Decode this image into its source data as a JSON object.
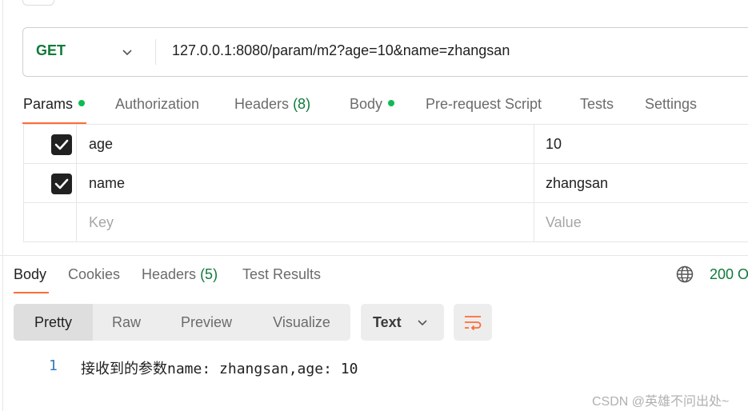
{
  "request": {
    "method": "GET",
    "url": "127.0.0.1:8080/param/m2?age=10&name=zhangsan"
  },
  "request_tabs": [
    {
      "label": "Params",
      "dot": true,
      "active": true
    },
    {
      "label": "Authorization"
    },
    {
      "label": "Headers",
      "count": "(8)"
    },
    {
      "label": "Body",
      "dot": true
    },
    {
      "label": "Pre-request Script"
    },
    {
      "label": "Tests"
    },
    {
      "label": "Settings"
    }
  ],
  "params": [
    {
      "key": "age",
      "value": "10",
      "checked": true
    },
    {
      "key": "name",
      "value": "zhangsan",
      "checked": true
    }
  ],
  "params_placeholder": {
    "key": "Key",
    "value": "Value"
  },
  "response_tabs": [
    {
      "label": "Body",
      "active": true
    },
    {
      "label": "Cookies"
    },
    {
      "label": "Headers",
      "count": "(5)"
    },
    {
      "label": "Test Results"
    }
  ],
  "status": "200 O",
  "view_modes": [
    "Pretty",
    "Raw",
    "Preview",
    "Visualize"
  ],
  "format": "Text",
  "response_body": {
    "line": "1",
    "text": "接收到的参数name: zhangsan,age: 10"
  },
  "watermark": "CSDN @英雄不问出处~",
  "colors": {
    "accent": "#ff6c37",
    "success": "#0cbb52",
    "method": "#0f7a3a"
  }
}
